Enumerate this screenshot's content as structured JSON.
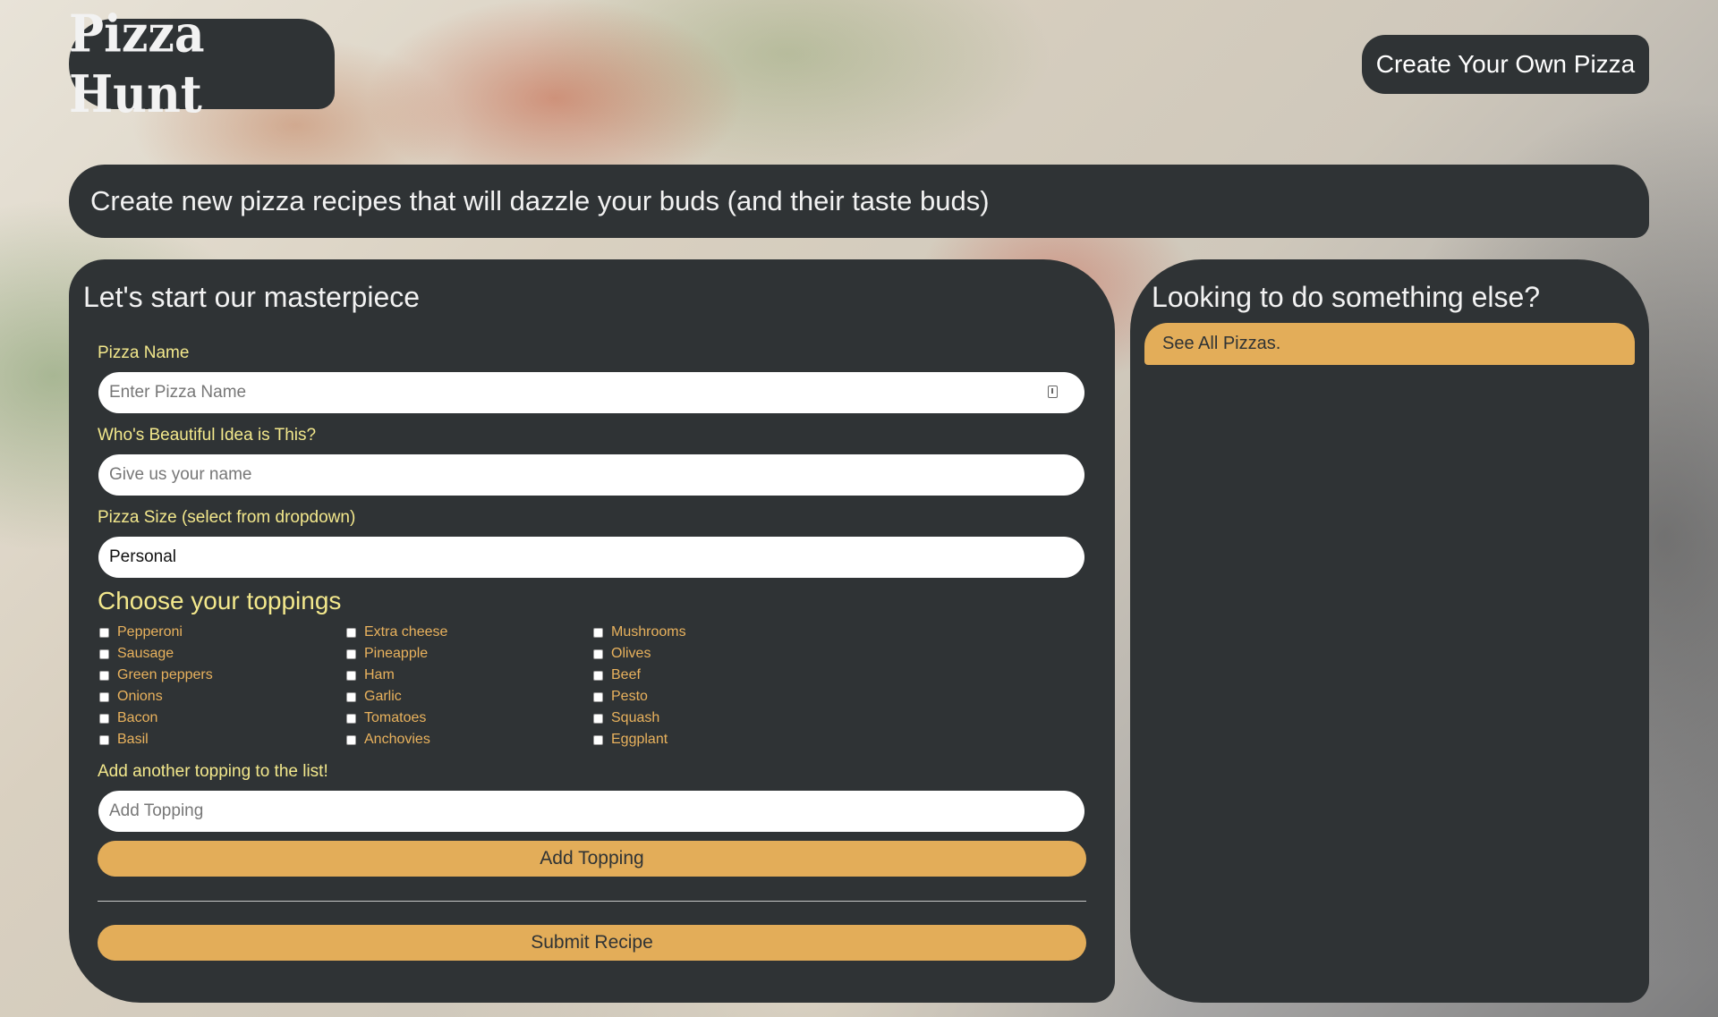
{
  "header": {
    "logo_text": "Pizza Hunt",
    "create_button": "Create Your Own Pizza",
    "tagline": "Create new pizza recipes that will dazzle your buds (and their taste buds)"
  },
  "form": {
    "title": "Let's start our masterpiece",
    "pizza_name": {
      "label": "Pizza Name",
      "placeholder": "Enter Pizza Name",
      "value": ""
    },
    "creator": {
      "label": "Who's Beautiful Idea is This?",
      "placeholder": "Give us your name",
      "value": ""
    },
    "size": {
      "label": "Pizza Size (select from dropdown)",
      "selected": "Personal"
    },
    "toppings_title": "Choose your toppings",
    "toppings": [
      [
        "Pepperoni",
        "Sausage",
        "Green peppers",
        "Onions",
        "Bacon",
        "Basil"
      ],
      [
        "Extra cheese",
        "Pineapple",
        "Ham",
        "Garlic",
        "Tomatoes",
        "Anchovies"
      ],
      [
        "Mushrooms",
        "Olives",
        "Beef",
        "Pesto",
        "Squash",
        "Eggplant"
      ]
    ],
    "add_topping": {
      "label": "Add another topping to the list!",
      "placeholder": "Add Topping",
      "value": "",
      "button": "Add Topping"
    },
    "submit_button": "Submit Recipe"
  },
  "sidebar": {
    "title": "Looking to do something else?",
    "link": "See All Pizzas."
  },
  "colors": {
    "panel": "#2f3335",
    "label_yellow": "#f3e88c",
    "topping_orange": "#e9b25d",
    "button_orange": "#e3ad59"
  },
  "icons": {
    "pizza_name_field": "password-key-icon"
  }
}
